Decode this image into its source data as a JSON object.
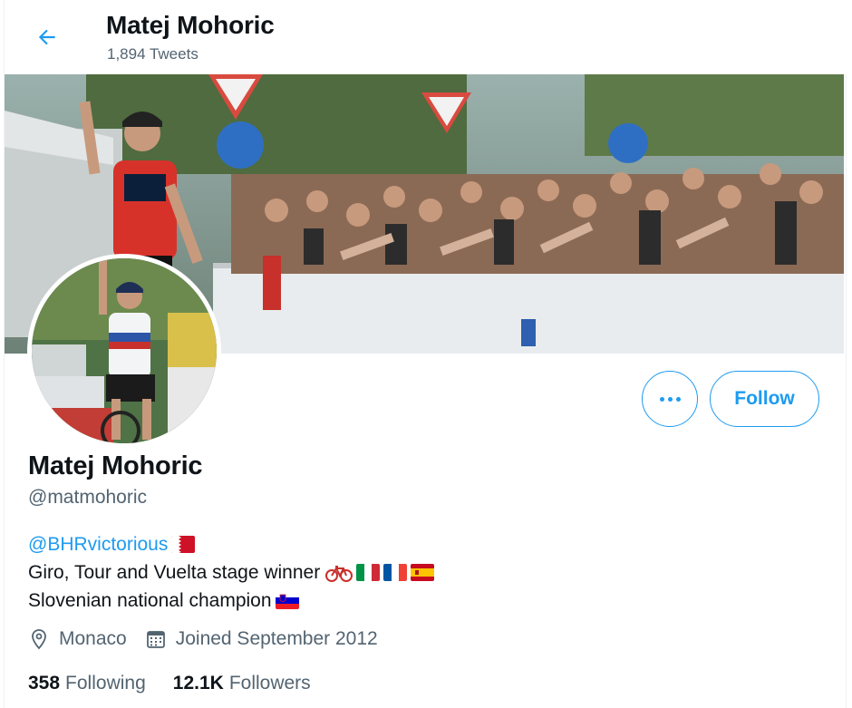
{
  "header": {
    "name": "Matej Mohoric",
    "tweet_count": "1,894 Tweets"
  },
  "profile": {
    "name": "Matej Mohoric",
    "handle": "@matmohoric",
    "bio": {
      "mention": "@BHRvictorious",
      "line2": "Giro, Tour and Vuelta stage winner",
      "line3": "Slovenian national champion"
    },
    "location": "Monaco",
    "joined": "Joined September 2012"
  },
  "stats": {
    "following_count": "358",
    "following_label": "Following",
    "followers_count": "12.1K",
    "followers_label": "Followers"
  },
  "buttons": {
    "follow": "Follow",
    "more": "More"
  },
  "colors": {
    "accent": "#1d9bf0",
    "text": "#0f1419",
    "muted": "#536471"
  },
  "icons": {
    "back": "arrow-left-icon",
    "more": "ellipsis-icon",
    "location": "location-pin-icon",
    "joined": "calendar-icon",
    "bike": "bicycle-emoji",
    "flags": [
      "bahrain-flag",
      "italy-flag",
      "france-flag",
      "spain-flag",
      "slovenia-flag"
    ]
  }
}
